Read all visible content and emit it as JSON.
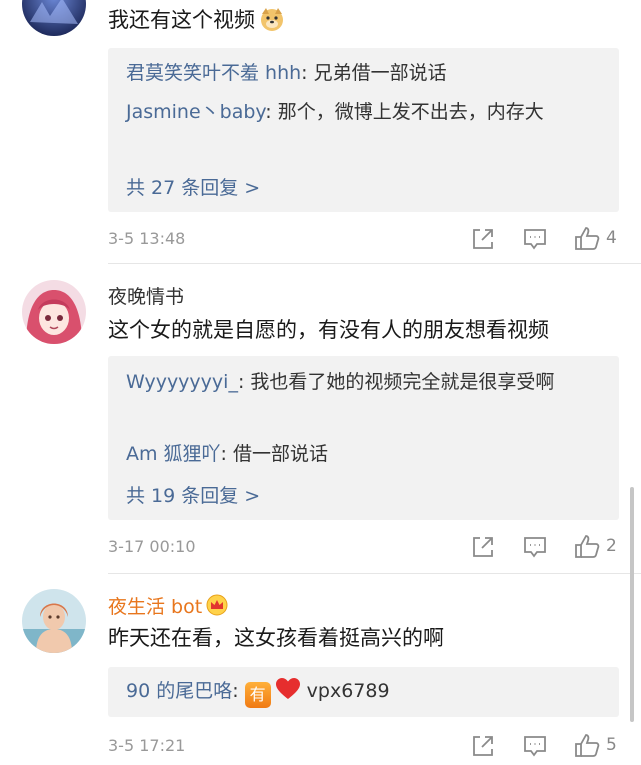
{
  "comments": [
    {
      "text": "我还有这个视频",
      "emoji": "doge-emoji",
      "replies": [
        {
          "name": "君莫笑笑叶不羞 hhh",
          "text": ": 兄弟借一部说话"
        },
        {
          "name": "Jasmine丶baby",
          "text": ": 那个，微博上发不出去，内存大"
        }
      ],
      "more": "共 27 条回复 >",
      "time": "3-5 13:48",
      "likes": "4"
    },
    {
      "username": "夜晚情书",
      "text": "这个女的就是自愿的，有没有人的朋友想看视频",
      "replies": [
        {
          "name": "Wyyyyyyyi_",
          "text": ": 我也看了她的视频完全就是很享受啊"
        },
        {
          "name": "Am 狐狸吖",
          "text": ": 借一部说话"
        }
      ],
      "more": "共 19 条回复 >",
      "time": "3-17 00:10",
      "likes": "2"
    },
    {
      "username": "夜生活 bot",
      "text": "昨天还在看，这女孩看着挺高兴的啊",
      "replies": [
        {
          "name": "90 的尾巴咯",
          "badge": "有",
          "text": "vpx6789"
        }
      ],
      "time": "3-5 17:21",
      "likes": "5"
    }
  ],
  "colors": {
    "link": "#4a6a96",
    "vip_name": "#e8761d",
    "reply_bg": "#f2f2f2"
  }
}
